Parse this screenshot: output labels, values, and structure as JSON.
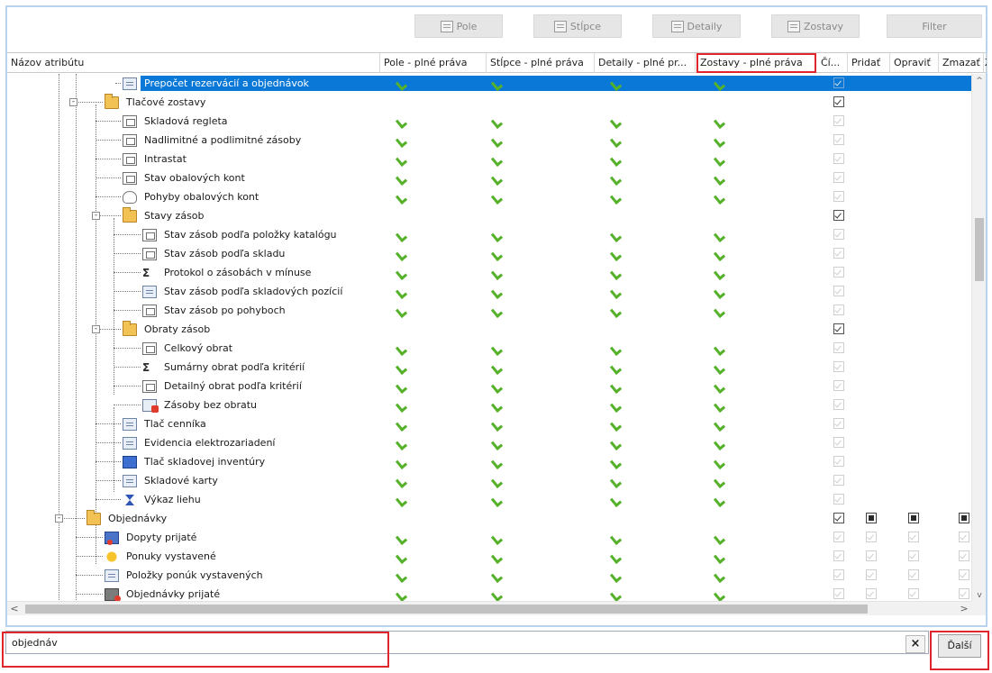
{
  "toolbar": {
    "buttons": [
      {
        "label": "Pole"
      },
      {
        "label": "Stĺpce"
      },
      {
        "label": "Detaily"
      },
      {
        "label": "Zostavy"
      },
      {
        "label": "Filter"
      }
    ]
  },
  "grid": {
    "columns": [
      {
        "label": "Názov atribútu"
      },
      {
        "label": "Pole - plné práva"
      },
      {
        "label": "Stĺpce - plné práva"
      },
      {
        "label": "Detaily - plné pr..."
      },
      {
        "label": "Zostavy - plné práva"
      },
      {
        "label": "Čí..."
      },
      {
        "label": "Pridať"
      },
      {
        "label": "Opraviť"
      },
      {
        "label": "Zmazať"
      },
      {
        "label": "Z"
      }
    ],
    "rows": [
      {
        "label": "Prepočet rezervácií a objednávok",
        "checks": true,
        "cb": "sel"
      },
      {
        "label": "Tlačové zostavy",
        "checks": false,
        "cb": "on"
      },
      {
        "label": "Skladová regleta",
        "checks": true,
        "cb": "dis"
      },
      {
        "label": "Nadlimitné a podlimitné zásoby",
        "checks": true,
        "cb": "dis"
      },
      {
        "label": "Intrastat",
        "checks": true,
        "cb": "dis"
      },
      {
        "label": "Stav obalových kont",
        "checks": true,
        "cb": "dis"
      },
      {
        "label": "Pohyby obalových kont",
        "checks": true,
        "cb": "dis"
      },
      {
        "label": "Stavy zásob",
        "checks": false,
        "cb": "on"
      },
      {
        "label": "Stav zásob podľa položky katalógu",
        "checks": true,
        "cb": "dis"
      },
      {
        "label": "Stav zásob podľa skladu",
        "checks": true,
        "cb": "dis"
      },
      {
        "label": "Protokol o zásobách v mínuse",
        "checks": true,
        "cb": "dis"
      },
      {
        "label": "Stav zásob podľa skladových pozícií",
        "checks": true,
        "cb": "dis"
      },
      {
        "label": "Stav zásob po pohyboch",
        "checks": true,
        "cb": "dis"
      },
      {
        "label": "Obraty zásob",
        "checks": false,
        "cb": "on"
      },
      {
        "label": "Celkový obrat",
        "checks": true,
        "cb": "dis"
      },
      {
        "label": "Sumárny obrat podľa kritérií",
        "checks": true,
        "cb": "dis"
      },
      {
        "label": "Detailný obrat podľa kritérií",
        "checks": true,
        "cb": "dis"
      },
      {
        "label": "Zásoby bez obratu",
        "checks": true,
        "cb": "dis"
      },
      {
        "label": "Tlač cenníka",
        "checks": true,
        "cb": "dis"
      },
      {
        "label": "Evidencia elektrozariadení",
        "checks": true,
        "cb": "dis"
      },
      {
        "label": "Tlač skladovej inventúry",
        "checks": true,
        "cb": "dis"
      },
      {
        "label": "Skladové karty",
        "checks": true,
        "cb": "dis"
      },
      {
        "label": "Výkaz liehu",
        "checks": true,
        "cb": "dis"
      },
      {
        "label": "Objednávky",
        "checks": false,
        "cb": "on",
        "extra": "sq"
      },
      {
        "label": "Dopyty prijaté",
        "checks": true,
        "cb": "dis",
        "extra": "dis"
      },
      {
        "label": "Ponuky vystavené",
        "checks": true,
        "cb": "dis",
        "extra": "dis"
      },
      {
        "label": "Položky ponúk vystavených",
        "checks": true,
        "cb": "dis",
        "extra": "dis"
      },
      {
        "label": "Objednávky prijaté",
        "checks": true,
        "cb": "dis",
        "extra": "dis"
      }
    ]
  },
  "search": {
    "value": "objednáv",
    "clear_label": "×",
    "next_label": "Ďalší"
  },
  "scroll": {
    "up": "^",
    "down": "v",
    "left": "<",
    "right": ">"
  }
}
